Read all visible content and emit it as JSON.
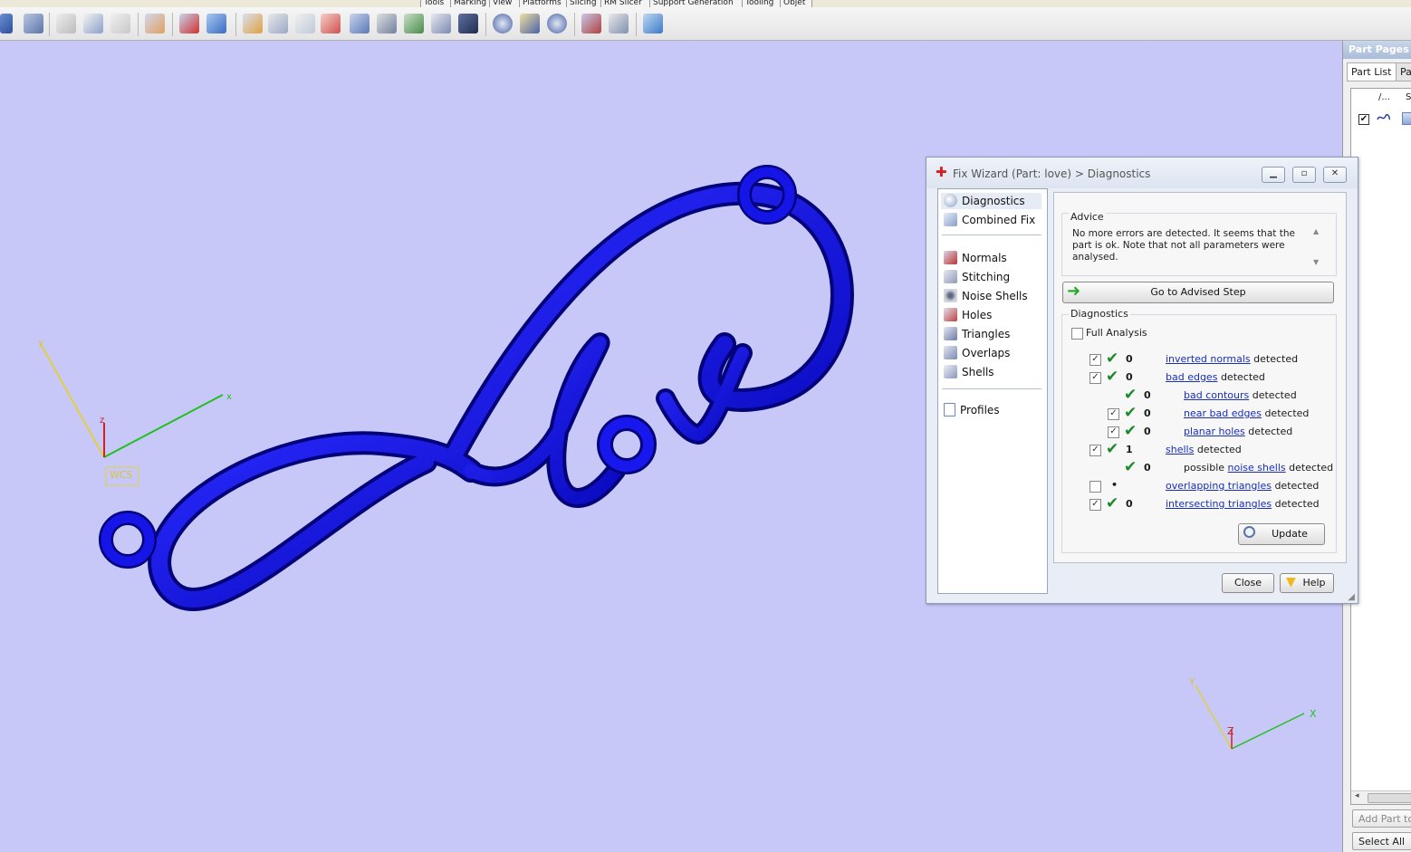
{
  "menu_tabs": [
    "Tools",
    "Marking",
    "View",
    "Platforms",
    "Slicing",
    "RM Slicer",
    "Support Generation",
    "Tooling",
    "Objet"
  ],
  "viewport": {
    "wcs_label": "WCS",
    "axis_x": "x",
    "axis_y": "y",
    "axis_z": "z",
    "mini_axis_x": "X",
    "mini_axis_y": "Y",
    "mini_axis_z": "Z"
  },
  "part_pages": {
    "title": "Part Pages",
    "tab_part_list": "Part List",
    "tab_other": "Pa",
    "col1": "/...",
    "col2": "S",
    "add_part_button": "Add Part to",
    "select_all_button": "Select All"
  },
  "dialog": {
    "title": "Fix Wizard (Part: love) > Diagnostics",
    "nav": {
      "diagnostics": "Diagnostics",
      "combined_fix": "Combined Fix",
      "normals": "Normals",
      "stitching": "Stitching",
      "noise_shells": "Noise Shells",
      "holes": "Holes",
      "triangles": "Triangles",
      "overlaps": "Overlaps",
      "shells": "Shells",
      "profiles": "Profiles"
    },
    "advice_label": "Advice",
    "advice_text": "No more errors are detected. It seems that the part is ok. Note that not all parameters were analysed.",
    "advised_step_button": "Go to Advised Step",
    "diagnostics_label": "Diagnostics",
    "full_analysis": "Full Analysis",
    "detected": "detected",
    "possible": "possible",
    "rows": {
      "inverted_normals": {
        "link": "inverted normals",
        "count": "0"
      },
      "bad_edges": {
        "link": "bad edges",
        "count": "0"
      },
      "bad_contours": {
        "link": "bad contours",
        "count": "0"
      },
      "near_bad_edges": {
        "link": "near bad edges",
        "count": "0"
      },
      "planar_holes": {
        "link": "planar holes",
        "count": "0"
      },
      "shells": {
        "link": "shells",
        "count": "1"
      },
      "noise_shells": {
        "link": "noise shells",
        "count": "0"
      },
      "overlapping_triangles": {
        "link": "overlapping triangles",
        "count": "•"
      },
      "intersecting_triangles": {
        "link": "intersecting triangles",
        "count": "0"
      }
    },
    "update_button": "Update",
    "close_button": "Close",
    "help_button": "Help"
  },
  "colors": {
    "viewport_bg": "#c8c8f8",
    "model": "#1010d8",
    "model_dark": "#04047a",
    "axis_x": "#20c020",
    "axis_y": "#e0d040",
    "axis_z": "#d02020",
    "link": "#1a2fb8",
    "check_green": "#1c8a2a"
  }
}
